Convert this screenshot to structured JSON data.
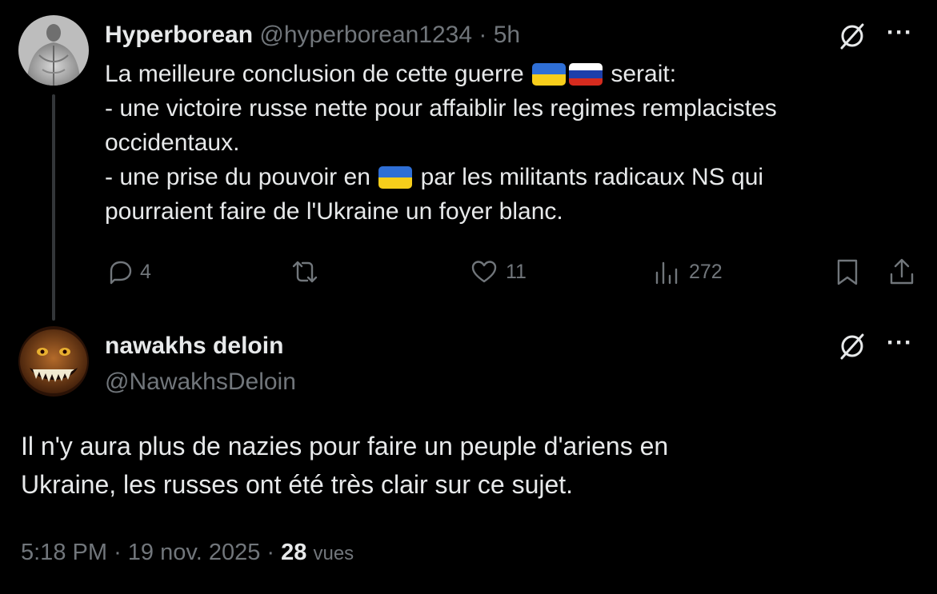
{
  "original_tweet": {
    "author_name": "Hyperborean",
    "handle": "@hyperborean1234",
    "separator": "·",
    "time": "5h",
    "avatar_icon": "statue-back-avatar",
    "lines": {
      "l1_before": "La meilleure conclusion de cette guerre",
      "l1_after": "serait:",
      "l2": "- une victoire russe nette pour affaiblir les regimes remplacistes",
      "l3": "occidentaux.",
      "l4_before": "- une prise du pouvoir en",
      "l4_after": "par les militants radicaux NS qui",
      "l5": "pourraient faire de l'Ukraine un foyer blanc."
    },
    "flags": [
      "ukraine-flag",
      "russia-flag",
      "ukraine-flag"
    ],
    "actions": {
      "replies": "4",
      "retweets": "",
      "likes": "11",
      "views": "272"
    },
    "more_label": "···"
  },
  "reply_tweet": {
    "author_name": "nawakhs deloin",
    "handle": "@NawakhsDeloin",
    "avatar_icon": "grinning-monster-avatar",
    "text_line1": "Il n'y aura plus de nazies pour faire un peuple d'ariens en",
    "text_line2": "Ukraine, les russes ont été très clair sur ce sujet.",
    "time": "5:18 PM",
    "sep1": "·",
    "date": "19 nov. 2025",
    "sep2": "·",
    "views_count": "28",
    "views_label": "vues",
    "more_label": "···"
  },
  "colors": {
    "background": "#000000",
    "text": "#e7e9ea",
    "muted": "#71767b",
    "ukraine_blue": "#2f6fd6",
    "ukraine_yellow": "#f7ce1b",
    "russia_white": "#ffffff",
    "russia_blue": "#1c3faa",
    "russia_red": "#d52b1e"
  }
}
